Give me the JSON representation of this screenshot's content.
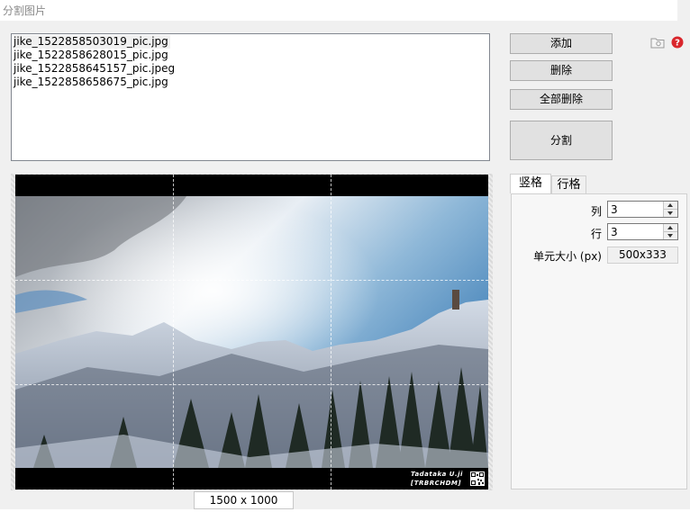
{
  "window": {
    "title": "分割图片"
  },
  "files": [
    "jike_1522858503019_pic.jpg",
    "jike_1522858628015_pic.jpg",
    "jike_1522858645157_pic.jpeg",
    "jike_1522858658675_pic.jpg"
  ],
  "buttons": {
    "add": "添加",
    "delete": "删除",
    "delete_all": "全部删除",
    "split": "分割"
  },
  "icons": {
    "folder": "folder-icon",
    "help": "help-icon"
  },
  "preview": {
    "dimensions": "1500 x 1000",
    "watermark_line1": "Tadataka U.ji",
    "watermark_line2": "[TRBRCHDM]",
    "grid_columns": 3,
    "grid_rows": 3
  },
  "tabs": {
    "vertical": "竖格",
    "horizontal": "行格"
  },
  "settings": {
    "columns_label": "列",
    "columns_value": "3",
    "rows_label": "行",
    "rows_value": "3",
    "cell_size_label": "单元大小 (px)",
    "cell_size_value": "500x333"
  },
  "colors": {
    "help_red": "#d9262c",
    "button_bg": "#e1e1e1",
    "panel_bg": "#f0f0f0"
  }
}
